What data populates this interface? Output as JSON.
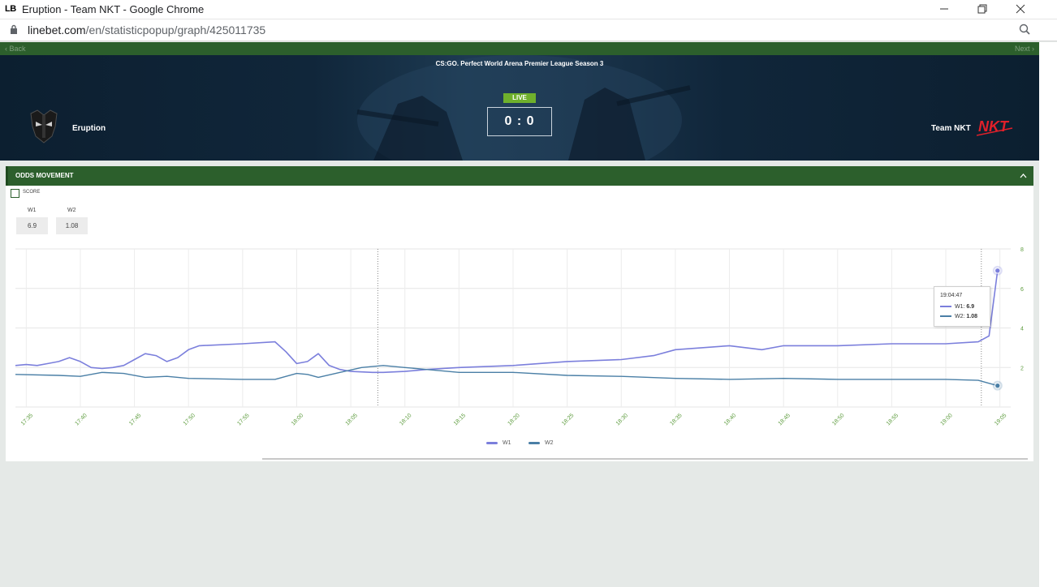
{
  "browser": {
    "window_title": "Eruption - Team NKT - Google Chrome",
    "favicon_text": "LB",
    "url_host": "linebet.com",
    "url_path": "/en/statisticpopup/graph/425011735"
  },
  "nav": {
    "back_label": "‹ Back",
    "next_label": "Next ›"
  },
  "match": {
    "tournament": "CS:GO. Perfect World Arena Premier League Season 3",
    "status": "LIVE",
    "score": "0 : 0",
    "team1": "Eruption",
    "team2": "Team NKT",
    "team2_logo_text": "NKT"
  },
  "panel": {
    "title": "ODDS MOVEMENT",
    "score_checkbox_label": "SCORE",
    "odds": [
      {
        "label": "W1",
        "value": "6.9"
      },
      {
        "label": "W2",
        "value": "1.08"
      }
    ]
  },
  "tooltip": {
    "time": "19:04:47",
    "rows": [
      {
        "label": "W1: ",
        "value": "6.9"
      },
      {
        "label": "W2: ",
        "value": "1.08"
      }
    ]
  },
  "colors": {
    "w1": "#7b7fdc",
    "w2": "#4a7fa6",
    "green": "#2c5f2c",
    "tick": "#5a9a3a"
  },
  "chart_data": {
    "type": "line",
    "x_label": "",
    "y_label": "",
    "x_ticks": [
      "17:35",
      "17:40",
      "17:45",
      "17:50",
      "17:55",
      "18:00",
      "18:05",
      "18:10",
      "18:15",
      "18:20",
      "18:25",
      "18:30",
      "18:35",
      "18:40",
      "18:45",
      "18:50",
      "18:55",
      "19:00",
      "19:05"
    ],
    "y_ticks": [
      2,
      4,
      6,
      8
    ],
    "ylim": [
      0,
      8
    ],
    "xlim": [
      "17:34",
      "19:06"
    ],
    "grid": true,
    "legend": "bottom",
    "series": [
      {
        "name": "W1",
        "points": [
          [
            "17:34",
            2.1
          ],
          [
            "17:35",
            2.15
          ],
          [
            "17:36",
            2.1
          ],
          [
            "17:37",
            2.2
          ],
          [
            "17:38",
            2.3
          ],
          [
            "17:39",
            2.5
          ],
          [
            "17:40",
            2.3
          ],
          [
            "17:41",
            2.0
          ],
          [
            "17:42",
            1.95
          ],
          [
            "17:43",
            2.0
          ],
          [
            "17:44",
            2.1
          ],
          [
            "17:45",
            2.4
          ],
          [
            "17:46",
            2.7
          ],
          [
            "17:47",
            2.6
          ],
          [
            "17:48",
            2.3
          ],
          [
            "17:49",
            2.5
          ],
          [
            "17:50",
            2.9
          ],
          [
            "17:51",
            3.1
          ],
          [
            "17:55",
            3.2
          ],
          [
            "17:58",
            3.3
          ],
          [
            "17:59",
            2.8
          ],
          [
            "18:00",
            2.2
          ],
          [
            "18:01",
            2.3
          ],
          [
            "18:02",
            2.7
          ],
          [
            "18:03",
            2.1
          ],
          [
            "18:04",
            1.9
          ],
          [
            "18:05",
            1.8
          ],
          [
            "18:07",
            1.75
          ],
          [
            "18:08",
            1.75
          ],
          [
            "18:10",
            1.8
          ],
          [
            "18:12",
            1.9
          ],
          [
            "18:15",
            2.0
          ],
          [
            "18:20",
            2.1
          ],
          [
            "18:25",
            2.3
          ],
          [
            "18:30",
            2.4
          ],
          [
            "18:33",
            2.6
          ],
          [
            "18:35",
            2.9
          ],
          [
            "18:40",
            3.1
          ],
          [
            "18:43",
            2.9
          ],
          [
            "18:45",
            3.1
          ],
          [
            "18:50",
            3.1
          ],
          [
            "18:55",
            3.2
          ],
          [
            "19:00",
            3.2
          ],
          [
            "19:03",
            3.3
          ],
          [
            "19:04",
            3.6
          ],
          [
            "19:04:47",
            6.9
          ]
        ]
      },
      {
        "name": "W2",
        "points": [
          [
            "17:34",
            1.65
          ],
          [
            "17:38",
            1.6
          ],
          [
            "17:40",
            1.55
          ],
          [
            "17:42",
            1.75
          ],
          [
            "17:44",
            1.7
          ],
          [
            "17:46",
            1.5
          ],
          [
            "17:48",
            1.55
          ],
          [
            "17:50",
            1.45
          ],
          [
            "17:55",
            1.4
          ],
          [
            "17:58",
            1.4
          ],
          [
            "18:00",
            1.7
          ],
          [
            "18:01",
            1.65
          ],
          [
            "18:02",
            1.5
          ],
          [
            "18:04",
            1.75
          ],
          [
            "18:06",
            2.0
          ],
          [
            "18:08",
            2.1
          ],
          [
            "18:10",
            2.0
          ],
          [
            "18:12",
            1.9
          ],
          [
            "18:15",
            1.75
          ],
          [
            "18:20",
            1.75
          ],
          [
            "18:25",
            1.6
          ],
          [
            "18:30",
            1.55
          ],
          [
            "18:35",
            1.45
          ],
          [
            "18:40",
            1.4
          ],
          [
            "18:45",
            1.45
          ],
          [
            "18:50",
            1.4
          ],
          [
            "18:55",
            1.4
          ],
          [
            "19:00",
            1.4
          ],
          [
            "19:03",
            1.35
          ],
          [
            "19:04:47",
            1.08
          ]
        ]
      }
    ]
  }
}
